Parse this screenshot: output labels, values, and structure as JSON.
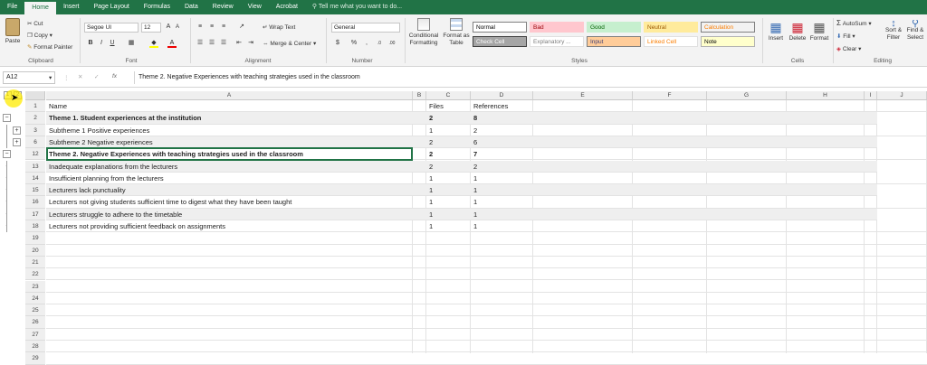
{
  "tabs": [
    "File",
    "Home",
    "Insert",
    "Page Layout",
    "Formulas",
    "Data",
    "Review",
    "View",
    "Acrobat"
  ],
  "active_tab": "Home",
  "tell_me": "Tell me what you want to do...",
  "ribbon": {
    "paste": "Paste",
    "cut": "Cut",
    "copy": "Copy",
    "format_painter": "Format Painter",
    "font_name": "Segoe UI",
    "font_size": "12",
    "wrap_text": "Wrap Text",
    "merge_center": "Merge & Center",
    "number_format": "General",
    "conditional_formatting": "Conditional Formatting",
    "format_as_table": "Format as Table",
    "styles": [
      {
        "label": "Normal",
        "bg": "#ffffff",
        "fg": "#000000",
        "border": "#7f7f7f"
      },
      {
        "label": "Bad",
        "bg": "#ffc7ce",
        "fg": "#9c0006",
        "border": "#ffc7ce"
      },
      {
        "label": "Good",
        "bg": "#c6efce",
        "fg": "#006100",
        "border": "#c6efce"
      },
      {
        "label": "Neutral",
        "bg": "#ffeb9c",
        "fg": "#9c5700",
        "border": "#ffeb9c"
      },
      {
        "label": "Calculation",
        "bg": "#f2f2f2",
        "fg": "#fa7d00",
        "border": "#7f7f7f"
      },
      {
        "label": "Check Cell",
        "bg": "#a5a5a5",
        "fg": "#ffffff",
        "border": "#3f3f3f"
      },
      {
        "label": "Explanatory ...",
        "bg": "#ffffff",
        "fg": "#7f7f7f",
        "border": "#e0e0e0"
      },
      {
        "label": "Input",
        "bg": "#ffcc99",
        "fg": "#3f3f76",
        "border": "#7f7f7f"
      },
      {
        "label": "Linked Cell",
        "bg": "#ffffff",
        "fg": "#fa7d00",
        "border": "#e0e0e0"
      },
      {
        "label": "Note",
        "bg": "#ffffcc",
        "fg": "#000000",
        "border": "#b2b2b2"
      }
    ],
    "insert": "Insert",
    "delete": "Delete",
    "format": "Format",
    "autosum": "AutoSum",
    "fill": "Fill",
    "clear": "Clear",
    "sort_filter": "Sort & Filter",
    "find_select": "Find & Select",
    "groups": {
      "clipboard": "Clipboard",
      "font": "Font",
      "alignment": "Alignment",
      "number": "Number",
      "styles": "Styles",
      "cells": "Cells",
      "editing": "Editing"
    }
  },
  "namebox": "A12",
  "fx": "fx",
  "formula": "Theme 2. Negative Experiences with teaching strategies used in the classroom",
  "columns": [
    "A",
    "B",
    "C",
    "D",
    "E",
    "F",
    "G",
    "H",
    "I",
    "J"
  ],
  "outline_levels": [
    "1",
    "2"
  ],
  "rows": [
    {
      "num": "1",
      "a": "Name",
      "c": "Files",
      "d": "References",
      "bold": false,
      "shade": false
    },
    {
      "num": "2",
      "a": "Theme 1. Student experiences at the institution",
      "c": "2",
      "d": "8",
      "bold": true,
      "shade": true
    },
    {
      "num": "3",
      "a": "  Subtheme 1  Positive experiences",
      "c": "1",
      "d": "2",
      "bold": false,
      "shade": false
    },
    {
      "num": "6",
      "a": "  Subtheme 2 Negative experiences",
      "c": "2",
      "d": "6",
      "bold": false,
      "shade": true
    },
    {
      "num": "12",
      "a": "Theme 2. Negative Experiences with teaching strategies used in the classroom",
      "c": "2",
      "d": "7",
      "bold": true,
      "shade": false
    },
    {
      "num": "13",
      "a": "  Inadequate explanations from the lecturers",
      "c": "2",
      "d": "2",
      "bold": false,
      "shade": true
    },
    {
      "num": "14",
      "a": "  Insufficient planning from the lecturers",
      "c": "1",
      "d": "1",
      "bold": false,
      "shade": false
    },
    {
      "num": "15",
      "a": "  Lecturers lack punctuality",
      "c": "1",
      "d": "1",
      "bold": false,
      "shade": true
    },
    {
      "num": "16",
      "a": "  Lecturers not giving students sufficient time to digest what they have been taught",
      "c": "1",
      "d": "1",
      "bold": false,
      "shade": false
    },
    {
      "num": "17",
      "a": "  Lecturers struggle to adhere to the timetable",
      "c": "1",
      "d": "1",
      "bold": false,
      "shade": true
    },
    {
      "num": "18",
      "a": "  Lecturers not providing sufficient feedback on assignments",
      "c": "1",
      "d": "1",
      "bold": false,
      "shade": false
    },
    {
      "num": "19",
      "a": "",
      "c": "",
      "d": "",
      "bold": false,
      "shade": false
    },
    {
      "num": "20",
      "a": "",
      "c": "",
      "d": "",
      "bold": false,
      "shade": false
    },
    {
      "num": "21",
      "a": "",
      "c": "",
      "d": "",
      "bold": false,
      "shade": false
    },
    {
      "num": "22",
      "a": "",
      "c": "",
      "d": "",
      "bold": false,
      "shade": false
    },
    {
      "num": "23",
      "a": "",
      "c": "",
      "d": "",
      "bold": false,
      "shade": false
    },
    {
      "num": "24",
      "a": "",
      "c": "",
      "d": "",
      "bold": false,
      "shade": false
    },
    {
      "num": "25",
      "a": "",
      "c": "",
      "d": "",
      "bold": false,
      "shade": false
    },
    {
      "num": "26",
      "a": "",
      "c": "",
      "d": "",
      "bold": false,
      "shade": false
    },
    {
      "num": "27",
      "a": "",
      "c": "",
      "d": "",
      "bold": false,
      "shade": false
    },
    {
      "num": "28",
      "a": "",
      "c": "",
      "d": "",
      "bold": false,
      "shade": false
    },
    {
      "num": "29",
      "a": "",
      "c": "",
      "d": "",
      "bold": false,
      "shade": false
    }
  ],
  "colors": {
    "excel_green": "#217346",
    "row_shade": "#efefef",
    "selection": "#217346"
  }
}
